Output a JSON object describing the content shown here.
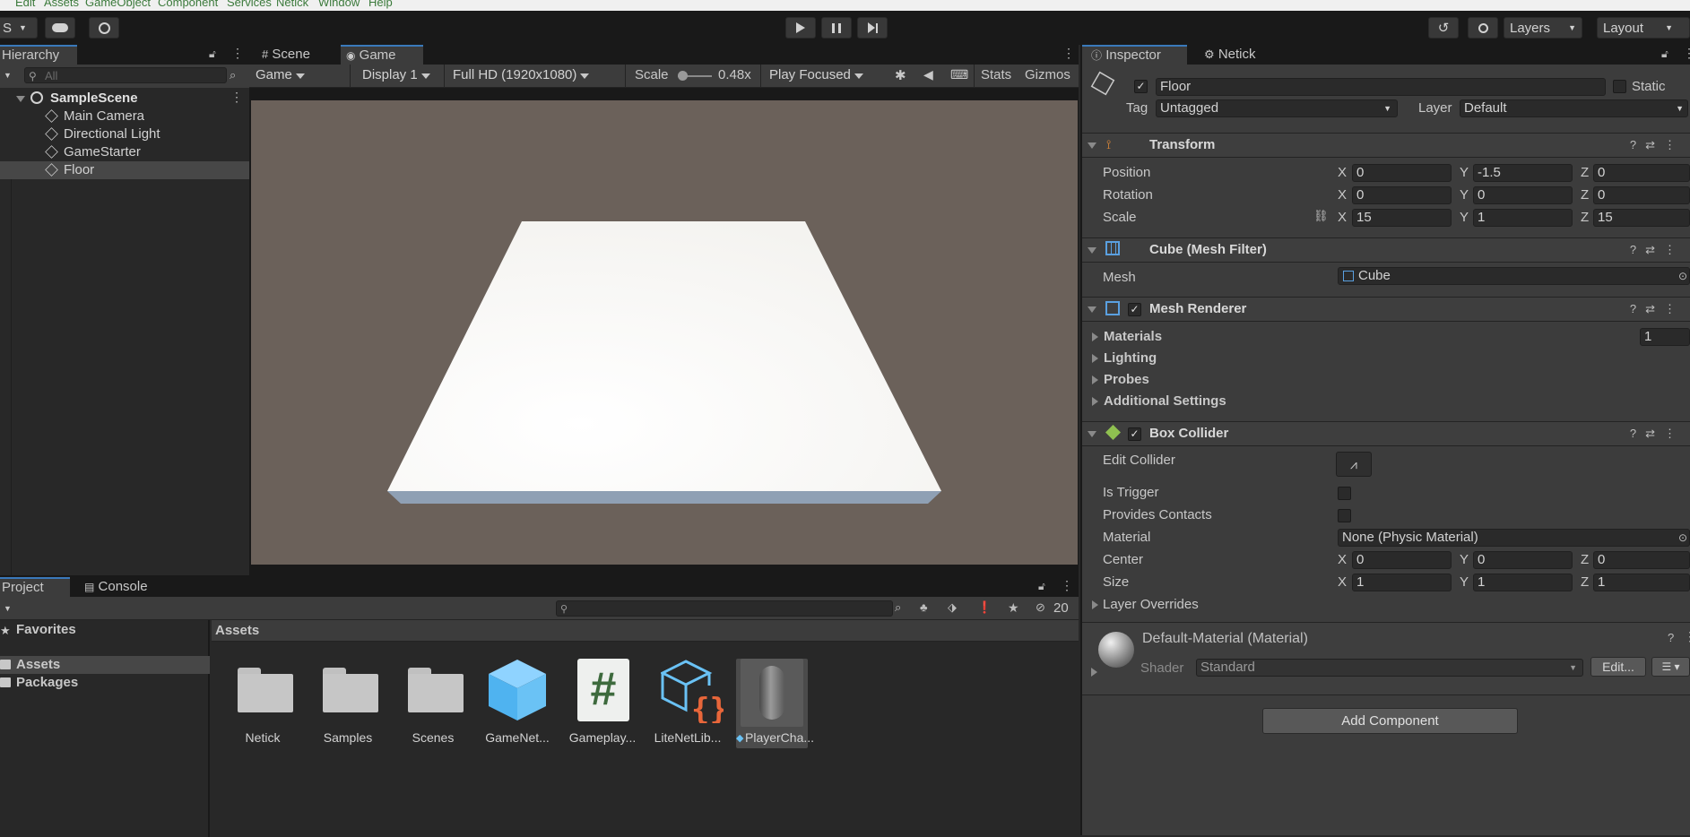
{
  "menu": [
    "Edit",
    "Assets",
    "GameObject",
    "Component",
    "Services",
    "Netick",
    "Window",
    "Help"
  ],
  "toolbar": {
    "account_initial": "S",
    "layers_label": "Layers",
    "layout_label": "Layout"
  },
  "hierarchy": {
    "title": "Hierarchy",
    "search_placeholder": "All",
    "scene": "SampleScene",
    "items": [
      "Main Camera",
      "Directional Light",
      "GameStarter",
      "Floor"
    ]
  },
  "game_view": {
    "tabs": [
      "Scene",
      "Game"
    ],
    "mode": "Game",
    "display": "Display 1",
    "resolution": "Full HD (1920x1080)",
    "scale_label": "Scale",
    "scale_value": "0.48x",
    "play_mode": "Play Focused",
    "stats": "Stats",
    "gizmos": "Gizmos"
  },
  "project": {
    "tabs": [
      "Project",
      "Console"
    ],
    "favorites": "Favorites",
    "tree": [
      "Assets",
      "Packages"
    ],
    "breadcrumb": "Assets",
    "hidden_count": "20",
    "assets": [
      "Netick",
      "Samples",
      "Scenes",
      "GameNet...",
      "Gameplay...",
      "LiteNetLib...",
      "PlayerCha..."
    ]
  },
  "inspector": {
    "tabs": [
      "Inspector",
      "Netick"
    ],
    "object_name": "Floor",
    "static_label": "Static",
    "tag_label": "Tag",
    "tag_value": "Untagged",
    "layer_label": "Layer",
    "layer_value": "Default",
    "transform": {
      "title": "Transform",
      "rows": [
        {
          "label": "Position",
          "x": "0",
          "y": "-1.5",
          "z": "0"
        },
        {
          "label": "Rotation",
          "x": "0",
          "y": "0",
          "z": "0"
        },
        {
          "label": "Scale",
          "x": "15",
          "y": "1",
          "z": "15"
        }
      ]
    },
    "mesh_filter": {
      "title": "Cube (Mesh Filter)",
      "mesh_label": "Mesh",
      "mesh_value": "Cube"
    },
    "mesh_renderer": {
      "title": "Mesh Renderer",
      "sections": [
        "Materials",
        "Lighting",
        "Probes",
        "Additional Settings"
      ],
      "materials_count": "1"
    },
    "box_collider": {
      "title": "Box Collider",
      "edit_label": "Edit Collider",
      "is_trigger": "Is Trigger",
      "provides_contacts": "Provides Contacts",
      "material_label": "Material",
      "material_value": "None (Physic Material)",
      "center": {
        "label": "Center",
        "x": "0",
        "y": "0",
        "z": "0"
      },
      "size": {
        "label": "Size",
        "x": "1",
        "y": "1",
        "z": "1"
      },
      "layer_overrides": "Layer Overrides"
    },
    "material": {
      "name": "Default-Material (Material)",
      "shader_label": "Shader",
      "shader_value": "Standard",
      "edit_label": "Edit..."
    },
    "add_component": "Add Component"
  },
  "colors": {
    "accent": "#3a79bb",
    "game_bg": "#6b615a",
    "floor": "#f8f8f6"
  }
}
